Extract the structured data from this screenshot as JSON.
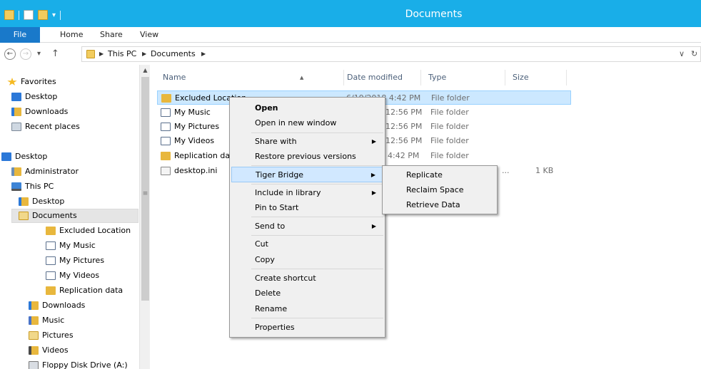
{
  "window": {
    "title": "Documents"
  },
  "ribbon": {
    "tabs": [
      "File",
      "Home",
      "Share",
      "View"
    ]
  },
  "address": {
    "crumbs": [
      "This PC",
      "Documents"
    ],
    "back_glyph": "←",
    "forward_glyph": "→",
    "up_glyph": "↑",
    "recent_glyph": "▾",
    "dropdown_glyph": "∨",
    "refresh_glyph": "↻"
  },
  "nav": {
    "items": [
      {
        "label": "Favorites",
        "icon": "star-icon"
      },
      {
        "label": "Desktop",
        "icon": "desktop-icon"
      },
      {
        "label": "Downloads",
        "icon": "downloads-folder-icon"
      },
      {
        "label": "Recent places",
        "icon": "recent-places-icon"
      },
      {
        "label": "Desktop",
        "icon": "desktop-icon"
      },
      {
        "label": "Administrator",
        "icon": "user-folder-icon"
      },
      {
        "label": "This PC",
        "icon": "computer-icon"
      },
      {
        "label": "Desktop",
        "icon": "desktop-folder-icon"
      },
      {
        "label": "Documents",
        "icon": "documents-folder-icon"
      },
      {
        "label": "Excluded Location",
        "icon": "folder-icon"
      },
      {
        "label": "My Music",
        "icon": "shortcut-icon"
      },
      {
        "label": "My Pictures",
        "icon": "shortcut-icon"
      },
      {
        "label": "My Videos",
        "icon": "shortcut-icon"
      },
      {
        "label": "Replication data",
        "icon": "folder-icon"
      },
      {
        "label": "Downloads",
        "icon": "downloads-folder-icon"
      },
      {
        "label": "Music",
        "icon": "music-folder-icon"
      },
      {
        "label": "Pictures",
        "icon": "pictures-folder-icon"
      },
      {
        "label": "Videos",
        "icon": "videos-folder-icon"
      },
      {
        "label": "Floppy Disk Drive (A:)",
        "icon": "floppy-drive-icon"
      }
    ],
    "selected_index": 8
  },
  "files": {
    "columns": [
      "Name",
      "Date modified",
      "Type",
      "Size"
    ],
    "rows": [
      {
        "name": "Excluded Location",
        "date": "6/19/2018 4:42 PM",
        "type": "File folder",
        "size": "",
        "icon": "folder-icon"
      },
      {
        "name": "My Music",
        "date": "12:56 PM",
        "type": "File folder",
        "size": "",
        "icon": "shortcut-icon"
      },
      {
        "name": "My Pictures",
        "date": "12:56 PM",
        "type": "File folder",
        "size": "",
        "icon": "shortcut-icon"
      },
      {
        "name": "My Videos",
        "date": "12:56 PM",
        "type": "File folder",
        "size": "",
        "icon": "shortcut-icon"
      },
      {
        "name": "Replication da",
        "date": "4:42 PM",
        "type": "File folder",
        "size": "",
        "icon": "folder-icon"
      },
      {
        "name": "desktop.ini",
        "date": "",
        "type": "...",
        "size": "1 KB",
        "icon": "settings-file-icon"
      }
    ]
  },
  "context_menu": {
    "items": [
      {
        "label": "Open",
        "bold": true
      },
      {
        "label": "Open in new window"
      },
      {
        "label": "Share with",
        "submenu": true
      },
      {
        "label": "Restore previous versions"
      },
      {
        "label": "Tiger Bridge",
        "submenu": true,
        "highlighted": true
      },
      {
        "label": "Include in library",
        "submenu": true
      },
      {
        "label": "Pin to Start"
      },
      {
        "label": "Send to",
        "submenu": true
      },
      {
        "label": "Cut"
      },
      {
        "label": "Copy"
      },
      {
        "label": "Create shortcut"
      },
      {
        "label": "Delete"
      },
      {
        "label": "Rename"
      },
      {
        "label": "Properties"
      }
    ],
    "submenu_arrow": "▶"
  },
  "submenu": {
    "items": [
      "Replicate",
      "Reclaim Space",
      "Retrieve Data"
    ]
  },
  "colors": {
    "title_bar": "#19aee8",
    "file_tab": "#1979ca",
    "selection": "#cce8ff",
    "menu_highlight": "#d1e8ff",
    "folder": "#e8b73d"
  }
}
